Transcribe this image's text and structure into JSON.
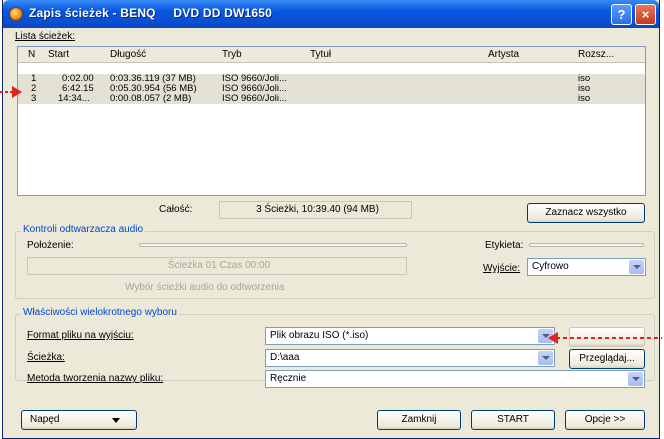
{
  "window": {
    "title": "Zapis ścieżek - BENQ     DVD DD DW1650",
    "help_label": "?",
    "close_label": "×"
  },
  "tracklist": {
    "section_label": "Lista ścieżek:",
    "columns": [
      "N",
      "Start",
      "Długość",
      "Tryb",
      "Tytuł",
      "Artysta",
      "Rozsz..."
    ],
    "rows": [
      [
        "1",
        "0:02.00",
        "0:03.36.119 (37 MB)",
        "ISO 9660/Joli...",
        "",
        "",
        "iso"
      ],
      [
        "2",
        "6:42.15",
        "0:05.30.954 (56 MB)",
        "ISO 9660/Joli...",
        "",
        "",
        "iso"
      ],
      [
        "3",
        "14:34...",
        "0:00.08.057 (2 MB)",
        "ISO 9660/Joli...",
        "",
        "",
        "iso"
      ]
    ],
    "total_label": "Całość:",
    "total_value": "3 Ścieżki,  10:39.40 (94 MB)",
    "select_all_button": "Zaznacz wszystko"
  },
  "audio": {
    "group_title": "Kontroli odtwarzacza audio",
    "position_label": "Położenie:",
    "status_text": "Ścieżka 01 Czas 00:00",
    "hint": "Wybór ścieżki audio do odtworzenia",
    "label_label": "Etykieta:",
    "output_label": "Wyjście:",
    "output_value": "Cyfrowo"
  },
  "multi": {
    "group_title": "Właściwości wielokrotnego wyboru",
    "format_label": "Format pliku na wyjściu:",
    "format_value": "Plik obrazu ISO (*.iso)",
    "path_label": "Ścieżka:",
    "path_value": "D:\\aaa",
    "browse_button": "Przeglądaj...",
    "naming_label": "Metoda tworzenia nazwy pliku:",
    "naming_value": "Ręcznie"
  },
  "footer": {
    "drive_button": "Napęd",
    "close_button": "Zamknij",
    "start_button": "START",
    "options_button": "Opcje >>"
  },
  "colors": {
    "title_bar": "#0a4fd1",
    "window_bg": "#ece9d8",
    "accent_group_title": "#0046d5",
    "annotation_arrow": "#e2231a"
  }
}
